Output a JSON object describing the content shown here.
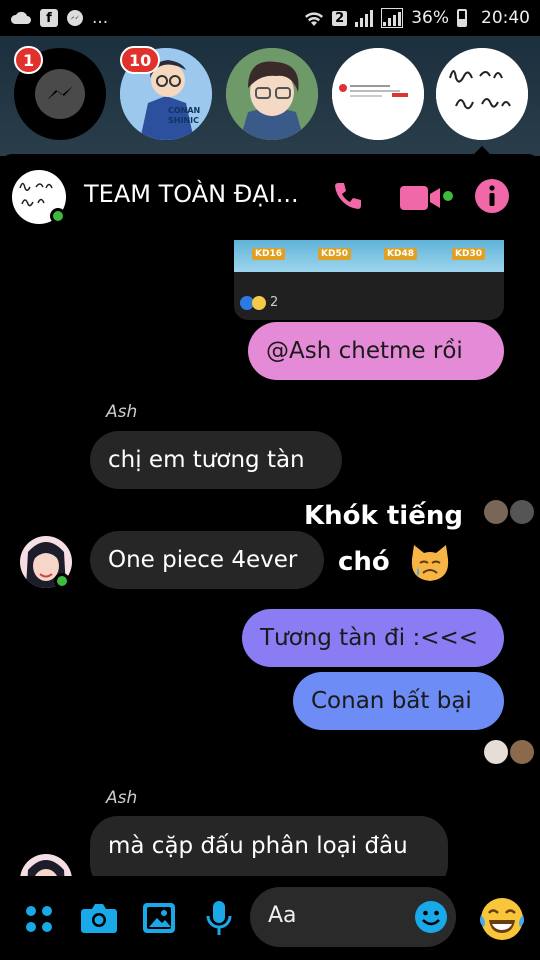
{
  "status_bar": {
    "sim": "2",
    "battery": "36%",
    "time": "20:40",
    "more": "..."
  },
  "chat_heads": [
    {
      "name": "messenger",
      "badge": "1"
    },
    {
      "name": "conan",
      "badge": "10",
      "caption": "CONAN SHINIC"
    },
    {
      "name": "anime-boy",
      "badge": ""
    },
    {
      "name": "screenshot",
      "badge": ""
    },
    {
      "name": "lop-du-du-thue",
      "badge": ""
    }
  ],
  "header": {
    "title": "TEAM TOÀN ĐẠI..."
  },
  "shared_image": {
    "labels": [
      "KD16",
      "KD50",
      "KD48",
      "KD30"
    ],
    "reaction_count": "2"
  },
  "messages": [
    {
      "id": "m1",
      "text": "@Ash chetme rồi",
      "direction": "out"
    },
    {
      "id": "m2",
      "sender": "Ash",
      "text": "chị em tương tàn",
      "direction": "in"
    },
    {
      "id": "m3",
      "text": "One piece 4ever",
      "direction": "in"
    },
    {
      "id": "m4",
      "text": "Tương tàn đi :<<<",
      "direction": "out"
    },
    {
      "id": "m5",
      "text": "Conan bất bại",
      "direction": "out"
    },
    {
      "id": "m6",
      "sender": "Ash",
      "text": "mà cặp đấu phân loại đâu",
      "direction": "in"
    }
  ],
  "overlay_text": [
    "Khók tiếng",
    "chó"
  ],
  "compose": {
    "placeholder": "Aa"
  },
  "colors": {
    "accent": "#f068a8",
    "pink_bubble": "#e58ad6",
    "purple_bubble": "#8a7cf3",
    "blue_bubble": "#6d8cf5",
    "toolbar_icon": "#19a8e8",
    "online": "#3fba3f"
  }
}
